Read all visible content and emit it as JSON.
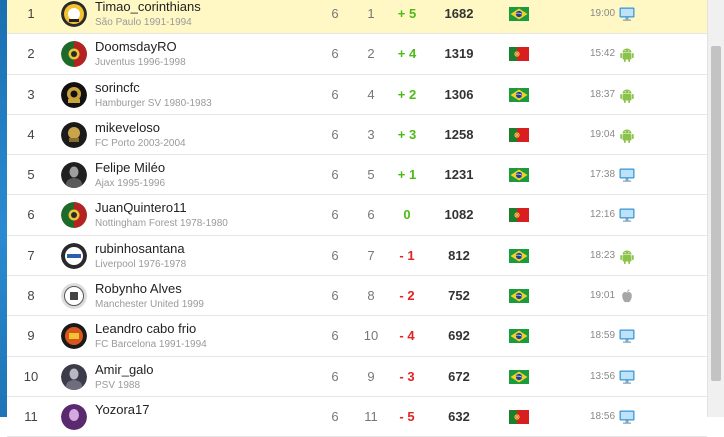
{
  "ranking": {
    "rows": [
      {
        "rank": "1",
        "name": "Timao_corinthians",
        "club": "São Paulo 1991-1994",
        "played": "6",
        "wins": "1",
        "diff": "+ 5",
        "diff_sign": "pos",
        "points": "1682",
        "country": "brazil",
        "time": "19:00",
        "device": "desktop",
        "avatar": "crest-yellow",
        "highlight": true
      },
      {
        "rank": "2",
        "name": "DoomsdayRO",
        "club": "Juventus 1996-1998",
        "played": "6",
        "wins": "2",
        "diff": "+ 4",
        "diff_sign": "pos",
        "points": "1319",
        "country": "portugal",
        "time": "15:42",
        "device": "android",
        "avatar": "crest-red-green",
        "highlight": false
      },
      {
        "rank": "3",
        "name": "sorincfc",
        "club": "Hamburger SV 1980-1983",
        "played": "6",
        "wins": "4",
        "diff": "+ 2",
        "diff_sign": "pos",
        "points": "1306",
        "country": "brazil",
        "time": "18:37",
        "device": "android",
        "avatar": "crest-black-gold",
        "highlight": false
      },
      {
        "rank": "4",
        "name": "mikeveloso",
        "club": "FC Porto 2003-2004",
        "played": "6",
        "wins": "3",
        "diff": "+ 3",
        "diff_sign": "pos",
        "points": "1258",
        "country": "portugal",
        "time": "19:04",
        "device": "android",
        "avatar": "crest-dark",
        "highlight": false
      },
      {
        "rank": "5",
        "name": "Felipe Miléo",
        "club": "Ajax 1995-1996",
        "played": "6",
        "wins": "5",
        "diff": "+ 1",
        "diff_sign": "pos",
        "points": "1231",
        "country": "brazil",
        "time": "17:38",
        "device": "desktop",
        "avatar": "photo-dark",
        "highlight": false
      },
      {
        "rank": "6",
        "name": "JuanQuintero11",
        "club": "Nottingham Forest 1978-1980",
        "played": "6",
        "wins": "6",
        "diff": "0",
        "diff_sign": "pos",
        "points": "1082",
        "country": "portugal",
        "time": "12:16",
        "device": "desktop",
        "avatar": "crest-red-green",
        "highlight": false
      },
      {
        "rank": "7",
        "name": "rubinhosantana",
        "club": "Liverpool 1976-1978",
        "played": "6",
        "wins": "7",
        "diff": "- 1",
        "diff_sign": "neg",
        "points": "812",
        "country": "brazil",
        "time": "18:23",
        "device": "android",
        "avatar": "crest-white-blue",
        "highlight": false
      },
      {
        "rank": "8",
        "name": "Robynho Alves",
        "club": "Manchester United 1999",
        "played": "6",
        "wins": "8",
        "diff": "- 2",
        "diff_sign": "neg",
        "points": "752",
        "country": "brazil",
        "time": "19:01",
        "device": "apple",
        "avatar": "crest-white",
        "highlight": false
      },
      {
        "rank": "9",
        "name": "Leandro cabo frio",
        "club": "FC Barcelona 1991-1994",
        "played": "6",
        "wins": "10",
        "diff": "- 4",
        "diff_sign": "neg",
        "points": "692",
        "country": "brazil",
        "time": "18:59",
        "device": "desktop",
        "avatar": "crest-orange",
        "highlight": false
      },
      {
        "rank": "10",
        "name": "Amir_galo",
        "club": "PSV 1988",
        "played": "6",
        "wins": "9",
        "diff": "- 3",
        "diff_sign": "neg",
        "points": "672",
        "country": "brazil",
        "time": "13:56",
        "device": "desktop",
        "avatar": "photo-grey",
        "highlight": false
      },
      {
        "rank": "11",
        "name": "Yozora17",
        "club": "",
        "played": "6",
        "wins": "11",
        "diff": "- 5",
        "diff_sign": "neg",
        "points": "632",
        "country": "portugal",
        "time": "18:56",
        "device": "desktop",
        "avatar": "photo-purple",
        "highlight": false
      }
    ]
  },
  "colors": {
    "highlight_row": "#fff8c4",
    "positive": "#4cbb17",
    "negative": "#e32222",
    "android": "#8bc34a",
    "desktop": "#3a9ad9"
  }
}
